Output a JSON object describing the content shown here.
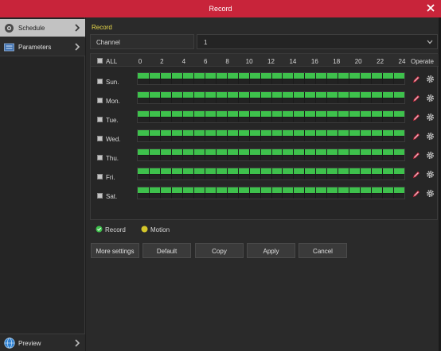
{
  "window": {
    "title": "Record"
  },
  "sidebar": {
    "items": [
      {
        "label": "Schedule",
        "icon": "camera-icon",
        "active": true
      },
      {
        "label": "Parameters",
        "icon": "settings-panel-icon",
        "active": false
      }
    ],
    "preview_label": "Preview"
  },
  "main": {
    "section_title": "Record",
    "channel": {
      "label": "Channel",
      "value": "1"
    },
    "grid": {
      "all_label": "ALL",
      "hour_ticks": [
        "0",
        "2",
        "4",
        "6",
        "8",
        "10",
        "12",
        "14",
        "16",
        "18",
        "20",
        "22",
        "24"
      ],
      "operate_label": "Operate",
      "days": [
        {
          "label": "Sun.",
          "record_fraction": 1.0
        },
        {
          "label": "Mon.",
          "record_fraction": 1.0
        },
        {
          "label": "Tue.",
          "record_fraction": 1.0
        },
        {
          "label": "Wed.",
          "record_fraction": 1.0
        },
        {
          "label": "Thu.",
          "record_fraction": 1.0
        },
        {
          "label": "Fri.",
          "record_fraction": 1.0
        },
        {
          "label": "Sat.",
          "record_fraction": 1.0
        }
      ]
    },
    "legend": [
      {
        "label": "Record",
        "color": "#3ec14c"
      },
      {
        "label": "Motion",
        "color": "#d4c62a"
      }
    ],
    "buttons": {
      "more_settings": "More settings",
      "default": "Default",
      "copy": "Copy",
      "apply": "Apply",
      "cancel": "Cancel"
    }
  },
  "colors": {
    "titlebar": "#c8243a",
    "accent_title": "#e8d84a",
    "record": "#3ec14c",
    "motion": "#d4c62a"
  }
}
